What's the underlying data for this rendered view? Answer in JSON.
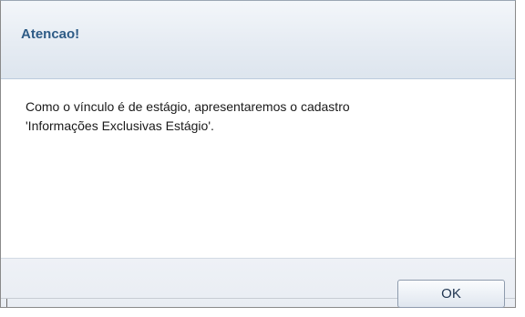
{
  "dialog": {
    "title": "Atencao!",
    "message_line1": "Como o vínculo é de estágio, apresentaremos o cadastro",
    "message_line2": "'Informações Exclusivas Estágio'.",
    "ok_label": "OK"
  },
  "colors": {
    "title_text": "#2e5b86",
    "titlebar_bg": "#e6ecf3",
    "footer_bg": "#eef1f6",
    "button_border": "#8e9bad"
  }
}
